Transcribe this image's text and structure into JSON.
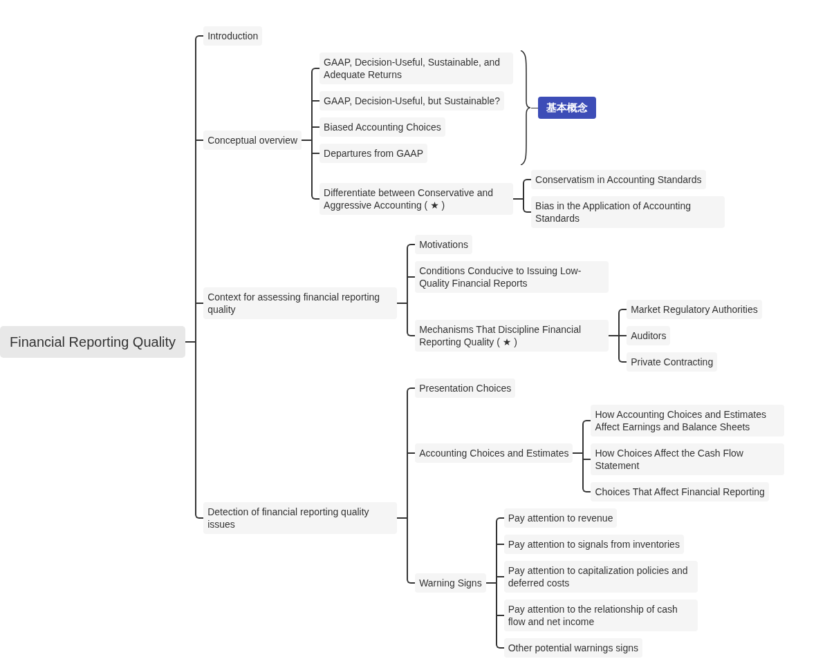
{
  "root": {
    "label": "Financial Reporting Quality",
    "children": [
      {
        "kind": "topic",
        "label": "Introduction"
      },
      {
        "kind": "topic",
        "label": "Conceptual overview",
        "children": [
          {
            "kind": "summary",
            "label": "基本概念",
            "children": [
              {
                "kind": "topic",
                "label": "GAAP, Decision-Useful, Sustainable, and Adequate Returns"
              },
              {
                "kind": "topic",
                "label": "GAAP, Decision-Useful, but Sustainable?"
              },
              {
                "kind": "topic",
                "label": "Biased Accounting Choices"
              },
              {
                "kind": "topic",
                "label": "Departures from GAAP"
              }
            ]
          },
          {
            "kind": "topic",
            "label": "Differentiate between Conservative and Aggressive Accounting ( ★ )",
            "children": [
              {
                "kind": "topic",
                "label": "Conservatism in Accounting Standards"
              },
              {
                "kind": "topic",
                "label": "Bias in the Application of Accounting Standards"
              }
            ]
          }
        ]
      },
      {
        "kind": "topic",
        "label": "Context for assessing financial reporting quality",
        "children": [
          {
            "kind": "topic",
            "label": "Motivations"
          },
          {
            "kind": "topic",
            "label": "Conditions Conducive to Issuing Low-Quality Financial Reports"
          },
          {
            "kind": "topic",
            "label": "Mechanisms That Discipline Financial Reporting Quality ( ★ )",
            "children": [
              {
                "kind": "topic",
                "label": "Market Regulatory Authorities"
              },
              {
                "kind": "topic",
                "label": "Auditors"
              },
              {
                "kind": "topic",
                "label": "Private Contracting"
              }
            ]
          }
        ]
      },
      {
        "kind": "topic",
        "label": "Detection of financial reporting quality issues",
        "children": [
          {
            "kind": "topic",
            "label": "Presentation Choices"
          },
          {
            "kind": "topic",
            "label": "Accounting Choices and Estimates",
            "children": [
              {
                "kind": "topic",
                "label": "How Accounting Choices and Estimates Affect Earnings and Balance Sheets"
              },
              {
                "kind": "topic",
                "label": "How Choices Affect the Cash Flow Statement"
              },
              {
                "kind": "topic",
                "label": "Choices That Affect Financial Reporting"
              }
            ]
          },
          {
            "kind": "topic",
            "label": "Warning Signs",
            "children": [
              {
                "kind": "topic",
                "label": "Pay attention to revenue"
              },
              {
                "kind": "topic",
                "label": "Pay attention to signals from inventories"
              },
              {
                "kind": "topic",
                "label": "Pay attention to capitalization policies and deferred costs"
              },
              {
                "kind": "topic",
                "label": "Pay attention to the relationship of cash flow and net income"
              },
              {
                "kind": "topic",
                "label": "Other potential warnings signs"
              }
            ]
          }
        ]
      }
    ]
  }
}
